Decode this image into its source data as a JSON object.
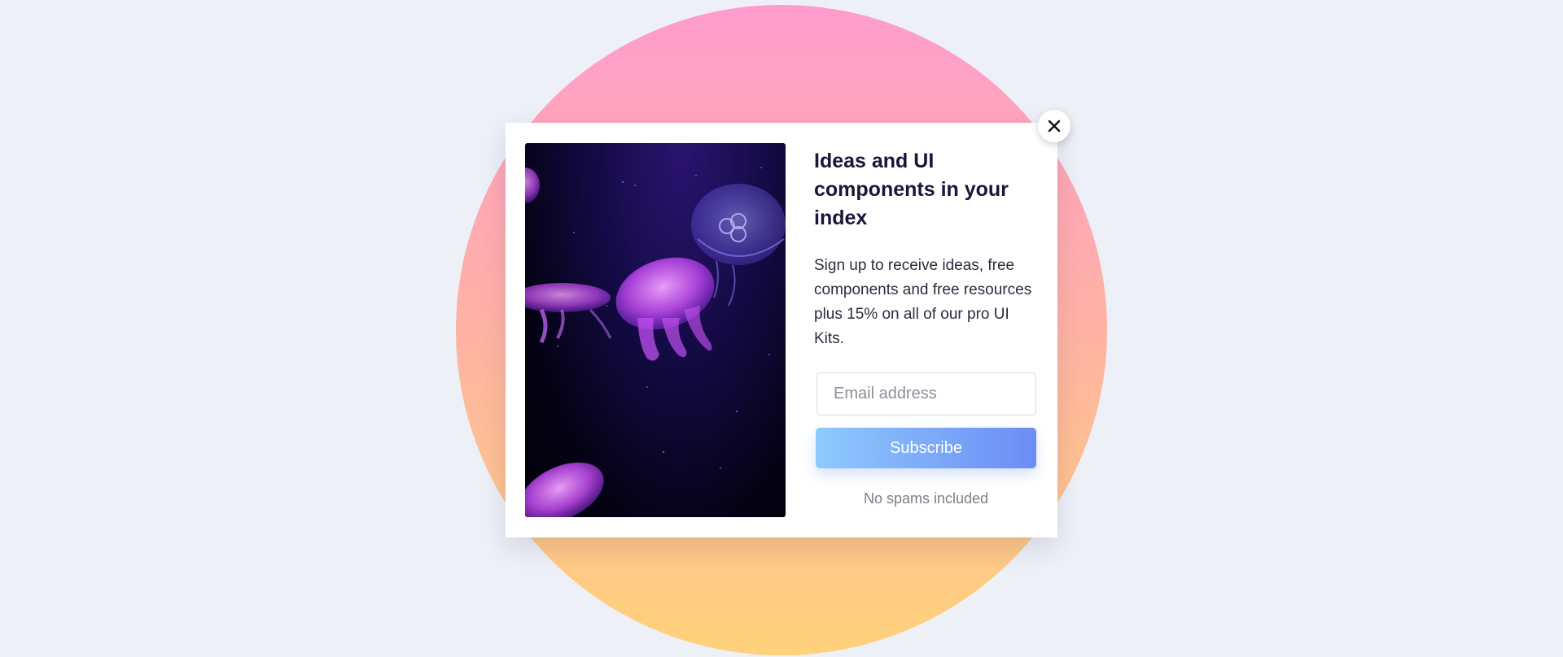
{
  "modal": {
    "title": "Ideas and UI components in your index",
    "description": "Sign up to receive ideas, free components and free resources plus 15% on all of our pro UI Kits.",
    "email": {
      "placeholder": "Email address",
      "value": ""
    },
    "subscribe_label": "Subscribe",
    "fineprint": "No spams included",
    "close_icon": "close-icon",
    "image_subject": "jellyfish"
  },
  "colors": {
    "background": "#edf0f7",
    "circle_top": "#ff9ccc",
    "circle_bottom": "#ffd27a",
    "button_start": "#8fcafc",
    "button_end": "#6b8cf6",
    "title": "#1b1538"
  }
}
